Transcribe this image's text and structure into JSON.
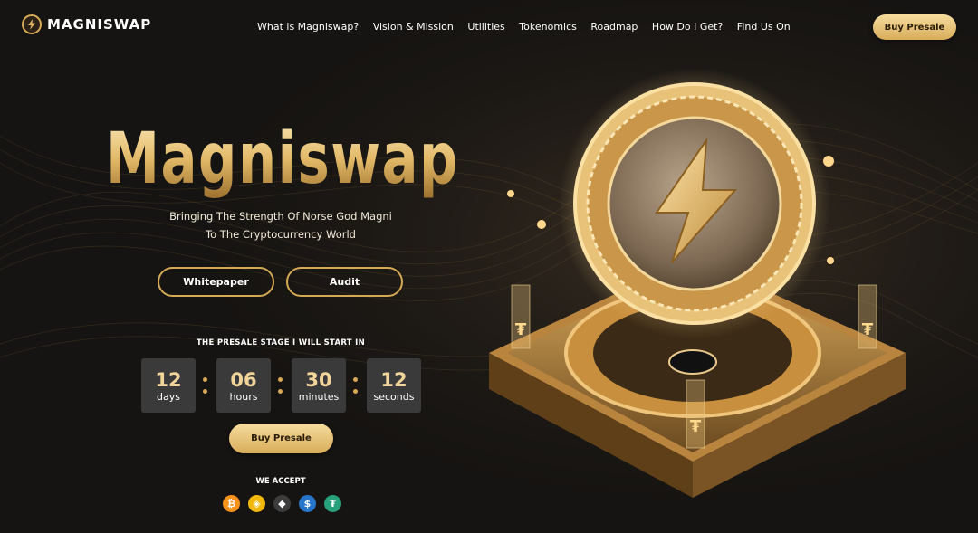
{
  "brand": {
    "name": "MAGNISWAP"
  },
  "nav": {
    "items": [
      "What is Magniswap?",
      "Vision & Mission",
      "Utilities",
      "Tokenomics",
      "Roadmap",
      "How Do I Get?",
      "Find Us On"
    ],
    "cta": "Buy Presale"
  },
  "hero": {
    "title": "Magniswap",
    "tagline_line1": "Bringing The Strength Of Norse God Magni",
    "tagline_line2": "To The Cryptocurrency World",
    "whitepaper": "Whitepaper",
    "audit": "Audit",
    "presale_label": "THE PRESALE STAGE I WILL START IN",
    "countdown": [
      {
        "value": "12",
        "unit": "days"
      },
      {
        "value": "06",
        "unit": "hours"
      },
      {
        "value": "30",
        "unit": "minutes"
      },
      {
        "value": "12",
        "unit": "seconds"
      }
    ],
    "cta": "Buy Presale",
    "accept_label": "WE ACCEPT",
    "coins": [
      {
        "icon": "bitcoin-icon",
        "glyph": "₿",
        "color": "#f7931a"
      },
      {
        "icon": "bnb-icon",
        "glyph": "◈",
        "color": "#f0b90b"
      },
      {
        "icon": "ethereum-icon",
        "glyph": "◆",
        "color": "#3c3c3d"
      },
      {
        "icon": "usdc-icon",
        "glyph": "$",
        "color": "#2775ca"
      },
      {
        "icon": "tether-icon",
        "glyph": "₮",
        "color": "#26a17b"
      }
    ]
  },
  "colors": {
    "accent": "#d6a957",
    "background": "#161412",
    "countdown_box": "#3a3a3a"
  }
}
